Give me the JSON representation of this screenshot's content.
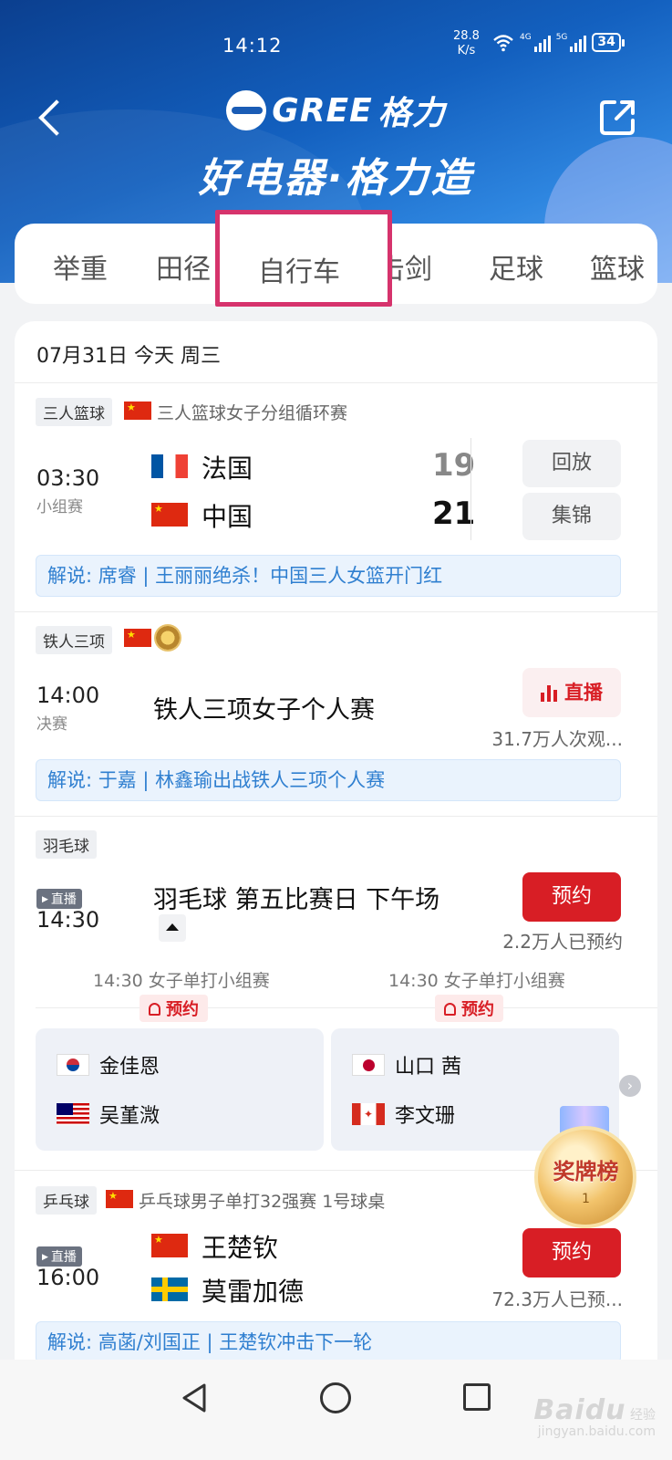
{
  "status": {
    "time": "14:12",
    "net_speed_value": "28.8",
    "net_speed_unit": "K/s",
    "sig1_tag": "4G",
    "sig2_tag": "5G",
    "battery": "34"
  },
  "header": {
    "brand_name": "GREE",
    "brand_cn": "格力",
    "slogan": "好电器·格力造"
  },
  "tabs": [
    {
      "label": "举重"
    },
    {
      "label": "田径"
    },
    {
      "label": "自行车",
      "active": true
    },
    {
      "label": "击剑"
    },
    {
      "label": "足球"
    },
    {
      "label": "篮球"
    }
  ],
  "date_header": "07月31日 今天 周三",
  "events": {
    "basketball": {
      "tag": "三人篮球",
      "title": "三人篮球女子分组循环赛",
      "time": "03:30",
      "stage": "小组赛",
      "team1": "法国",
      "score1": "19",
      "team2": "中国",
      "score2": "21",
      "btn_replay": "回放",
      "btn_highlights": "集锦",
      "commentary": "解说: 席睿 | 王丽丽绝杀！中国三人女篮开门红"
    },
    "triathlon": {
      "tag": "铁人三项",
      "time": "14:00",
      "stage": "决赛",
      "title": "铁人三项女子个人赛",
      "btn_live": "直播",
      "viewers": "31.7万人次观...",
      "commentary": "解说: 于嘉 | 林鑫瑜出战铁人三项个人赛"
    },
    "badminton": {
      "tag": "羽毛球",
      "live_badge": "直播",
      "time": "14:30",
      "title": "羽毛球 第五比赛日 下午场",
      "btn_reserve": "预约",
      "reserved": "2.2万人已预约",
      "matches": [
        {
          "subtitle": "14:30 女子单打小组赛",
          "remind": "预约",
          "player1": "金佳恩",
          "player2": "吴堇溦"
        },
        {
          "subtitle": "14:30 女子单打小组赛",
          "remind": "预约",
          "player1": "山口 茜",
          "player2": "李文珊"
        }
      ]
    },
    "table_tennis": {
      "tag": "乒乓球",
      "title": "乒乓球男子单打32强赛 1号球桌",
      "live_badge": "直播",
      "time": "16:00",
      "player1": "王楚钦",
      "player2": "莫雷加德",
      "btn_reserve": "预约",
      "reserved": "72.3万人已预...",
      "commentary": "解说: 高菡/刘国正 | 王楚钦冲击下一轮"
    }
  },
  "medal_widget": {
    "label": "奖牌榜",
    "number": "1"
  },
  "watermark": {
    "logo": "Baidu",
    "cn": "经验",
    "url": "jingyan.baidu.com"
  },
  "colors": {
    "accent_red": "#d81e25",
    "header_blue": "#1360bf",
    "highlight_pink": "#d6336c",
    "link_blue": "#2f7fd0"
  }
}
